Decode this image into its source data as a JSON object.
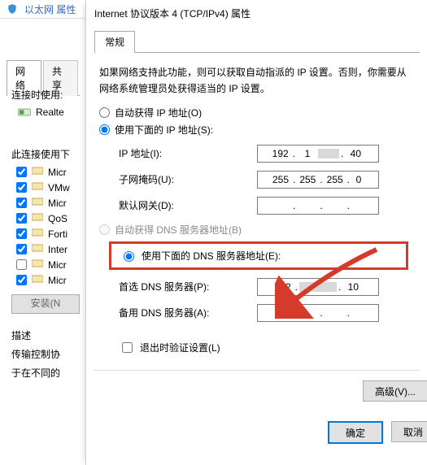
{
  "iconbar_text": "以太网 属性",
  "back": {
    "tab_network": "网络",
    "tab_share": "共享",
    "connect_label": "连接时使用:",
    "nic_name": "Realte",
    "services_label": "此连接使用下",
    "items": [
      {
        "checked": true,
        "label": "Micr"
      },
      {
        "checked": true,
        "label": "VMw"
      },
      {
        "checked": true,
        "label": "Micr"
      },
      {
        "checked": true,
        "label": "QoS"
      },
      {
        "checked": true,
        "label": "Forti"
      },
      {
        "checked": true,
        "label": "Inter"
      },
      {
        "checked": false,
        "label": "Micr"
      },
      {
        "checked": true,
        "label": "Micr"
      }
    ],
    "install_btn": "安装(N",
    "desc_label": "描述",
    "desc_line1": "传输控制协",
    "desc_line2": "于在不同的"
  },
  "front": {
    "title": "Internet 协议版本 4 (TCP/IPv4) 属性",
    "tab": "常规",
    "intro": "如果网络支持此功能，则可以获取自动指派的 IP 设置。否则，你需要从网络系统管理员处获得适当的 IP 设置。",
    "radio_auto_ip": "自动获得 IP 地址(O)",
    "radio_use_ip": "使用下面的 IP 地址(S):",
    "ip_label": "IP 地址(I):",
    "ip_value": {
      "o1": "192",
      "o2": "1",
      "o4": "40"
    },
    "mask_label": "子网掩码(U):",
    "mask_value": {
      "o1": "255",
      "o2": "255",
      "o3": "255",
      "o4": "0"
    },
    "gw_label": "默认网关(D):",
    "radio_auto_dns": "自动获得 DNS 服务器地址(B)",
    "radio_use_dns": "使用下面的 DNS 服务器地址(E):",
    "dns1_label": "首选 DNS 服务器(P):",
    "dns1_value": {
      "o1": "192",
      "o4": "10"
    },
    "dns2_label": "备用 DNS 服务器(A):",
    "validate_label": "退出时验证设置(L)",
    "adv_btn": "高级(V)...",
    "ok_btn": "确定",
    "cancel_btn": "取消"
  }
}
